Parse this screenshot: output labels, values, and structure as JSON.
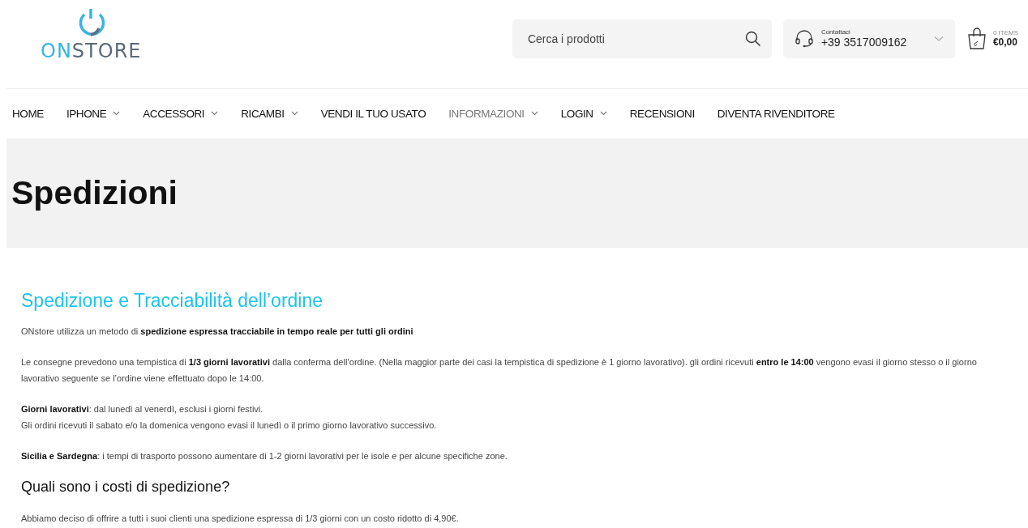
{
  "logo": {
    "part_1": "ON",
    "part_2": "STORE"
  },
  "search": {
    "placeholder": "Cerca i prodotti"
  },
  "contact": {
    "label": "Contattaci",
    "phone": "+39 3517009162"
  },
  "cart": {
    "count": "0 ITEMS",
    "total": "€0,00"
  },
  "nav": [
    {
      "label": "HOME",
      "has_menu": false,
      "selected": false
    },
    {
      "label": "IPHONE",
      "has_menu": true,
      "selected": false
    },
    {
      "label": "ACCESSORI",
      "has_menu": true,
      "selected": false
    },
    {
      "label": "RICAMBI",
      "has_menu": true,
      "selected": false
    },
    {
      "label": "VENDI IL TUO USATO",
      "has_menu": false,
      "selected": false
    },
    {
      "label": "INFORMAZIONI",
      "has_menu": true,
      "selected": true
    },
    {
      "label": "LOGIN",
      "has_menu": true,
      "selected": false
    },
    {
      "label": "RECENSIONI",
      "has_menu": false,
      "selected": false
    },
    {
      "label": "DIVENTA RIVENDITORE",
      "has_menu": false,
      "selected": false
    }
  ],
  "page_title": "Spedizioni",
  "content": [
    {
      "kind": "heading",
      "text": "Spedizione e Tracciabilità dell’ordine"
    },
    {
      "kind": "paragraph",
      "lines": [
        "ONstore utilizza un metodo di **spedizione espressa tracciabile in tempo reale per tutti gli ordini**"
      ]
    },
    {
      "kind": "paragraph",
      "lines": [
        "Le consegne prevedono una tempistica di **1/3 giorni lavorativi** dalla conferma dell’ordine. (Nella maggior parte dei casi la tempistica di spedizione è 1 giorno lavorativo). gli ordini ricevuti **entro le 14:00** vengono evasi il giorno stesso o il giorno lavorativo seguente se l’ordine viene effettuato dopo le 14:00."
      ]
    },
    {
      "kind": "paragraph",
      "lines": [
        "**Giorni lavorativi**: dal lunedì al venerdì, esclusi i giorni festivi.",
        "Gli ordini ricevuti il sabato e/o la domenica vengono evasi il lunedì o il primo giorno lavorativo successivo."
      ]
    },
    {
      "kind": "paragraph",
      "lines": [
        "**Sicilia e Sardegna**: i tempi di trasporto possono aumentare di 1-2 giorni lavorativi per le isole e per alcune specifiche zone."
      ]
    },
    {
      "kind": "subheading",
      "text": "Quali sono i costi di spedizione?"
    },
    {
      "kind": "paragraph",
      "lines": [
        "Abbiamo deciso di offrire a tutti i suoi clienti una spedizione espressa di 1/3 giorni con un costo ridotto di 4,90€."
      ]
    }
  ]
}
